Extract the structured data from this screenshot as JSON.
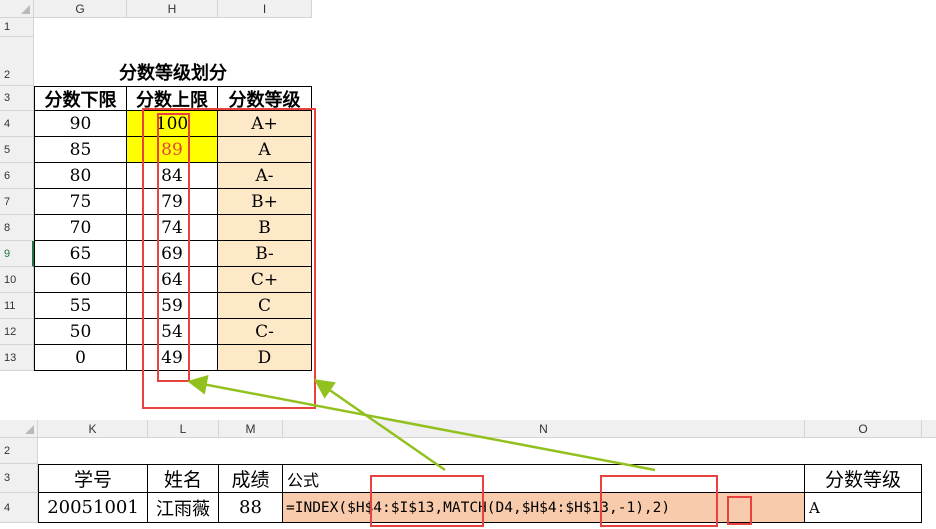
{
  "top": {
    "col_headers": [
      "G",
      "H",
      "I"
    ],
    "row_headers": [
      "1",
      "2",
      "3",
      "4",
      "5",
      "6",
      "7",
      "8",
      "9",
      "10",
      "11",
      "12",
      "13"
    ],
    "title": "分数等级划分",
    "headers": [
      "分数下限",
      "分数上限",
      "分数等级"
    ],
    "rows": [
      {
        "low": "90",
        "high": "100",
        "grade": "A+"
      },
      {
        "low": "85",
        "high": "89",
        "grade": "A"
      },
      {
        "low": "80",
        "high": "84",
        "grade": "A-"
      },
      {
        "low": "75",
        "high": "79",
        "grade": "B+"
      },
      {
        "low": "70",
        "high": "74",
        "grade": "B"
      },
      {
        "low": "65",
        "high": "69",
        "grade": "B-"
      },
      {
        "low": "60",
        "high": "64",
        "grade": "C+"
      },
      {
        "low": "55",
        "high": "59",
        "grade": "C"
      },
      {
        "low": "50",
        "high": "54",
        "grade": "C-"
      },
      {
        "low": "0",
        "high": "49",
        "grade": "D"
      }
    ]
  },
  "bottom": {
    "col_headers": [
      "K",
      "L",
      "M",
      "N",
      "O"
    ],
    "row_headers": [
      "2",
      "3",
      "4"
    ],
    "headers": {
      "id": "学号",
      "name": "姓名",
      "score": "成绩",
      "formula": "公式",
      "grade": "分数等级"
    },
    "row": {
      "id": "20051001",
      "name": "江雨薇",
      "score": "88",
      "formula": "=INDEX($H$4:$I$13,MATCH(D4,$H$4:$H$13,-1),2)",
      "grade": "A"
    }
  },
  "colors": {
    "highlight_yellow": "#ffff00",
    "grade_fill": "#fde9c8",
    "formula_fill": "#f8cbad",
    "red_box": "#e8423f",
    "arrow_green": "#92c11f",
    "red_text": "#e8423f"
  }
}
